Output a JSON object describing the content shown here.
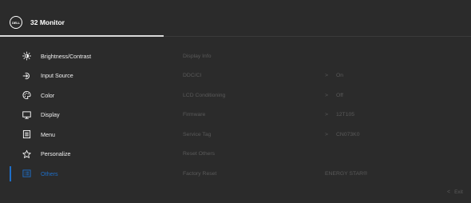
{
  "header": {
    "logo_text": "DELL",
    "title": "32 Monitor"
  },
  "menu": [
    {
      "label": "Brightness/Contrast",
      "icon": "sun-icon"
    },
    {
      "label": "Input Source",
      "icon": "input-source-icon"
    },
    {
      "label": "Color",
      "icon": "palette-icon"
    },
    {
      "label": "Display",
      "icon": "display-icon"
    },
    {
      "label": "Menu",
      "icon": "menu-icon"
    },
    {
      "label": "Personalize",
      "icon": "star-icon"
    },
    {
      "label": "Others",
      "icon": "others-icon",
      "active": true
    }
  ],
  "submenu": [
    {
      "label": "Display Info"
    },
    {
      "label": "DDC/CI"
    },
    {
      "label": "LCD Conditioning"
    },
    {
      "label": "Firmware"
    },
    {
      "label": "Service Tag"
    },
    {
      "label": "Reset Others"
    },
    {
      "label": "Factory Reset"
    }
  ],
  "values": [
    {
      "chevron": "",
      "value": ""
    },
    {
      "chevron": ">",
      "value": "On"
    },
    {
      "chevron": ">",
      "value": "Off"
    },
    {
      "chevron": ">",
      "value": "12T105"
    },
    {
      "chevron": ">",
      "value": "CN073K0"
    },
    {
      "chevron": "",
      "value": ""
    },
    {
      "chevron": "",
      "value": "ENERGY STAR®"
    }
  ],
  "footer": {
    "exit_chevron": "<",
    "exit_label": "Exit"
  },
  "colors": {
    "accent": "#1e6fc9",
    "background": "#2b2b2b",
    "dim_text": "#5a5a5a"
  }
}
